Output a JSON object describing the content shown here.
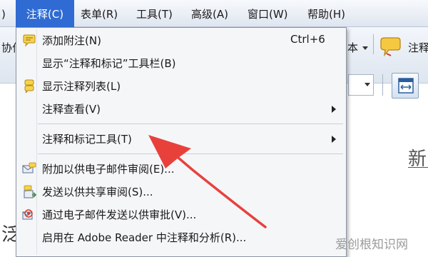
{
  "menubar": {
    "left_fragment": ")",
    "items": [
      {
        "label": "注释(C)"
      },
      {
        "label": "表单(R)"
      },
      {
        "label": "工具(T)"
      },
      {
        "label": "高级(A)"
      },
      {
        "label": "窗口(W)"
      },
      {
        "label": "帮助(H)"
      }
    ]
  },
  "toolbar": {
    "left_text": "协作",
    "right_text": "本",
    "annotate_label": "注释"
  },
  "menu": {
    "items": [
      {
        "label": "添加附注(N)",
        "shortcut": "Ctrl+6",
        "icon": "sticky-note-icon"
      },
      {
        "label": "显示“注释和标记”工具栏(B)",
        "icon": ""
      },
      {
        "label": "显示注释列表(L)",
        "icon": "comment-list-icon"
      },
      {
        "label": "注释查看(V)",
        "icon": "",
        "submenu": true
      },
      {
        "label": "注释和标记工具(T)",
        "icon": "",
        "submenu": true
      },
      {
        "label": "附加以供电子邮件审阅(E)...",
        "icon": "email-review-icon"
      },
      {
        "label": "发送以供共享审阅(S)...",
        "icon": "shared-review-icon"
      },
      {
        "label": "通过电子邮件发送以供审批(V)...",
        "icon": "email-approval-icon"
      },
      {
        "label": "启用在 Adobe Reader 中注释和分析(R)...",
        "icon": ""
      }
    ]
  },
  "document": {
    "char_right": "新",
    "char_left": "泛"
  },
  "watermark": "爱创根知识网",
  "colors": {
    "menubar_active": "#2f6bd2",
    "arrow": "#e8413c"
  }
}
